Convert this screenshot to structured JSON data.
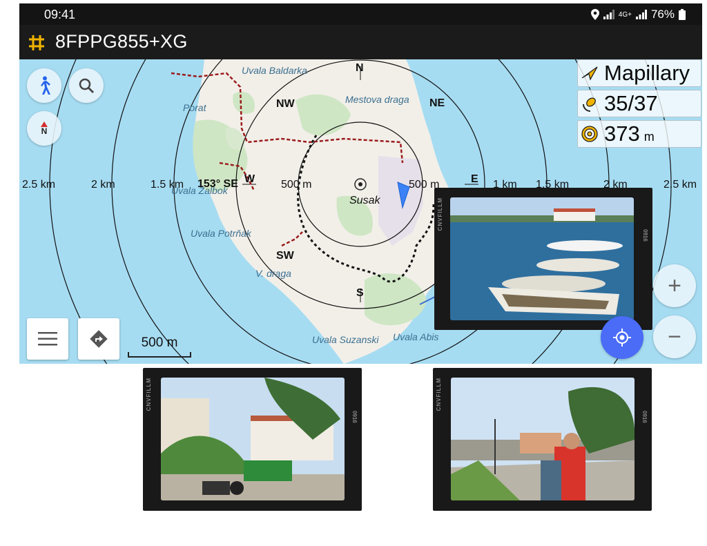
{
  "status_bar": {
    "time": "09:41",
    "network": "4G+",
    "battery": "76%"
  },
  "title_bar": {
    "title": "8FPPG855+XG",
    "icon": "grid-icon"
  },
  "info_panel": {
    "source": "Mapillary",
    "satellites": "35/37",
    "accuracy": "373",
    "accuracy_unit": "m"
  },
  "map": {
    "distance_labels": [
      "2.5 km",
      "2 km",
      "1.5 km",
      "500 m",
      "500 m",
      "1 km",
      "1.5 km",
      "2 km",
      "2.5 km"
    ],
    "bearing": "153° SE",
    "compass": [
      "N",
      "NE",
      "E",
      "S",
      "SW",
      "W",
      "NW"
    ],
    "places": [
      "Uvala Baldarka",
      "Porat",
      "Mestova draga",
      "Uvala Zalbok",
      "Susak",
      "Uvala Potrňak",
      "V. draga",
      "Uvala Suzanski",
      "Uvala Abis"
    ],
    "scale": "500 m"
  },
  "buttons": {
    "walk": "walk-icon",
    "search": "search-icon",
    "compass": "N",
    "menu": "menu-icon",
    "directions": "directions-icon",
    "zoom_in": "+",
    "zoom_out": "−",
    "locate": "locate-icon"
  },
  "photos": [
    {
      "brand": "CNVFILLM",
      "number": "0916"
    },
    {
      "brand": "CNVFILLM",
      "number": "0916"
    },
    {
      "brand": "CNVFILLM",
      "number": "0916"
    }
  ],
  "colors": {
    "sea": "#a6dcf2",
    "land": "#f2efe9",
    "forest": "#cfe6c4",
    "accent": "#4a6cf7",
    "route": "#9b1c1c"
  }
}
